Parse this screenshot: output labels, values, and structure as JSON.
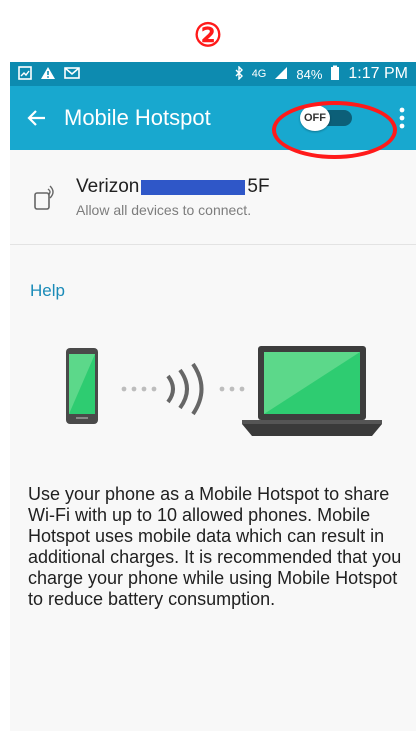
{
  "annotation": {
    "step_label": "②",
    "highlight_color": "#ff1a1a"
  },
  "status_bar": {
    "time": "1:17 PM",
    "battery": "84%",
    "network": "4G",
    "left_icons": [
      "gallery-icon",
      "warning-icon",
      "gmail-icon"
    ],
    "right_icons": [
      "bluetooth-icon",
      "lte-icon",
      "signal-icon",
      "battery-icon"
    ]
  },
  "app_bar": {
    "title": "Mobile Hotspot",
    "toggle_label": "OFF",
    "color": "#18a8cf"
  },
  "network": {
    "name_prefix": "Verizon",
    "name_suffix": "5F",
    "subtitle": "Allow all devices to connect."
  },
  "help_label": "Help",
  "description": "Use your phone as a Mobile Hotspot to share Wi-Fi with up to 10 allowed phones. Mobile Hotspot uses mobile data which can result in additional charges. It is recommended that you charge your phone while using Mobile Hotspot to reduce battery consumption."
}
